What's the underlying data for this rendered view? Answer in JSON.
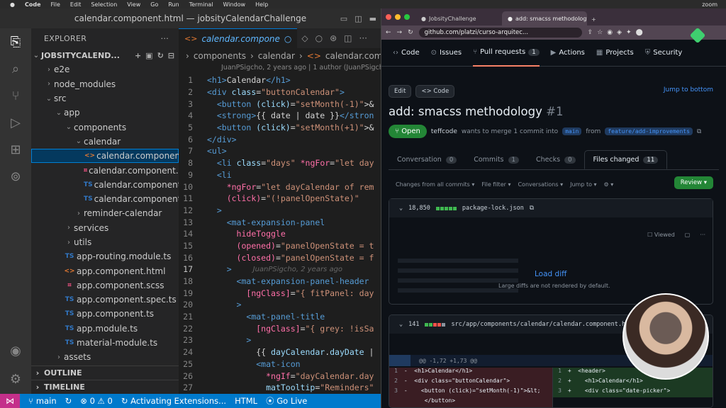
{
  "mac_menu": {
    "app": "Code",
    "items": [
      "File",
      "Edit",
      "Selection",
      "View",
      "Go",
      "Run",
      "Terminal",
      "Window",
      "Help"
    ],
    "right": [
      "zoom"
    ]
  },
  "vscode": {
    "window_title": "calendar.component.html — jobsityCalendarChallenge",
    "explorer_label": "EXPLORER",
    "project": "JOBSITYCALEND...",
    "tree": [
      {
        "label": "e2e",
        "depth": 1,
        "type": "folder",
        "open": false
      },
      {
        "label": "node_modules",
        "depth": 1,
        "type": "folder",
        "open": false
      },
      {
        "label": "src",
        "depth": 1,
        "type": "folder",
        "open": true
      },
      {
        "label": "app",
        "depth": 2,
        "type": "folder",
        "open": true
      },
      {
        "label": "components",
        "depth": 3,
        "type": "folder",
        "open": true
      },
      {
        "label": "calendar",
        "depth": 4,
        "type": "folder",
        "open": true
      },
      {
        "label": "calendar.component.html",
        "depth": 5,
        "type": "html",
        "state": "selected"
      },
      {
        "label": "calendar.component.scss",
        "depth": 5,
        "type": "scss",
        "state": "hover"
      },
      {
        "label": "calendar.component.sp...",
        "depth": 5,
        "type": "ts"
      },
      {
        "label": "calendar.component.ts",
        "depth": 5,
        "type": "ts"
      },
      {
        "label": "reminder-calendar",
        "depth": 4,
        "type": "folder",
        "open": false
      },
      {
        "label": "services",
        "depth": 3,
        "type": "folder",
        "open": false
      },
      {
        "label": "utils",
        "depth": 3,
        "type": "folder",
        "open": false
      },
      {
        "label": "app-routing.module.ts",
        "depth": 3,
        "type": "ts"
      },
      {
        "label": "app.component.html",
        "depth": 3,
        "type": "html"
      },
      {
        "label": "app.component.scss",
        "depth": 3,
        "type": "scss"
      },
      {
        "label": "app.component.spec.ts",
        "depth": 3,
        "type": "ts"
      },
      {
        "label": "app.component.ts",
        "depth": 3,
        "type": "ts"
      },
      {
        "label": "app.module.ts",
        "depth": 3,
        "type": "ts"
      },
      {
        "label": "material-module.ts",
        "depth": 3,
        "type": "ts"
      },
      {
        "label": "assets",
        "depth": 2,
        "type": "folder",
        "open": false
      }
    ],
    "outline_label": "OUTLINE",
    "timeline_label": "TIMELINE",
    "tab_label": "calendar.compone",
    "breadcrumb": [
      "components",
      "calendar",
      "calendar.compone"
    ],
    "blame_header": "JuanPSigcho, 2 years ago | 1 author (JuanPSigch...",
    "inline_blame": "JuanPSigcho, 2 years ago",
    "current_line": 17,
    "code": [
      {
        "n": 1,
        "html": "<span class='t'>&lt;h1&gt;</span>Calendar<span class='t'>&lt;/h1&gt;</span>"
      },
      {
        "n": 2,
        "html": "<span class='t'>&lt;div</span> <span class='a'>class</span>=<span class='s'>\"buttonCalendar\"</span><span class='t'>&gt;</span>"
      },
      {
        "n": 3,
        "html": "  <span class='t'>&lt;button</span> <span class='a'>(click)</span>=<span class='s'>\"setMonth(-1)\"</span>&gt;&amp;"
      },
      {
        "n": 4,
        "html": "  <span class='t'>&lt;strong&gt;</span>{{ date | date }}<span class='t'>&lt;/stron</span>"
      },
      {
        "n": 5,
        "html": "  <span class='t'>&lt;button</span> <span class='a'>(click)</span>=<span class='s'>\"setMonth(+1)\"</span>&gt;&amp;"
      },
      {
        "n": 6,
        "html": "<span class='t'>&lt;/div&gt;</span>"
      },
      {
        "n": 7,
        "html": "<span class='t'>&lt;ul&gt;</span>"
      },
      {
        "n": 8,
        "html": "  <span class='t'>&lt;li</span> <span class='a'>class</span>=<span class='s'>\"days\"</span> <span class='pk'>*ngFor</span>=<span class='s'>\"let day</span>"
      },
      {
        "n": 9,
        "html": "  <span class='t'>&lt;li</span>"
      },
      {
        "n": 10,
        "html": "    <span class='pk'>*ngFor</span>=<span class='s'>\"let dayCalendar of rem</span>"
      },
      {
        "n": 11,
        "html": "    <span class='pk'>(click)</span>=<span class='s'>\"(!panelOpenState)\"</span>"
      },
      {
        "n": 12,
        "html": "  <span class='t'>&gt;</span>"
      },
      {
        "n": 13,
        "html": "    <span class='t'>&lt;mat-expansion-panel</span>"
      },
      {
        "n": 14,
        "html": "      <span class='pk'>hideToggle</span>"
      },
      {
        "n": 15,
        "html": "      <span class='pk'>(opened)</span>=<span class='s'>\"panelOpenState = t</span>"
      },
      {
        "n": 16,
        "html": "      <span class='pk'>(closed)</span>=<span class='s'>\"panelOpenState = f</span>"
      },
      {
        "n": 17,
        "html": "    <span class='t'>&gt;</span>"
      },
      {
        "n": 18,
        "html": "      <span class='t'>&lt;mat-expansion-panel-header</span>"
      },
      {
        "n": 19,
        "html": "        <span class='pk'>[ngClass]</span>=<span class='s'>\"{ fitPanel: day</span>"
      },
      {
        "n": 20,
        "html": "      <span class='t'>&gt;</span>"
      },
      {
        "n": 21,
        "html": "        <span class='t'>&lt;mat-panel-title</span>"
      },
      {
        "n": 22,
        "html": "          <span class='pk'>[ngClass]</span>=<span class='s'>\"{ grey: !isSa</span>"
      },
      {
        "n": 23,
        "html": "        <span class='t'>&gt;</span>"
      },
      {
        "n": 24,
        "html": "          {{ <span class='a'>dayCalendar</span>.<span class='a'>dayDate</span> |"
      },
      {
        "n": 25,
        "html": "          <span class='t'>&lt;mat-icon</span>"
      },
      {
        "n": 26,
        "html": "            <span class='pk'>*ngIf</span>=<span class='s'>\"dayCalendar.day</span>"
      },
      {
        "n": 27,
        "html": "            <span class='a'>matTooltip</span>=<span class='s'>\"Reminders\"</span>"
      }
    ],
    "status": {
      "branch": "main",
      "errors": "0",
      "warnings": "0",
      "activity": "Activating Extensions...",
      "lang": "HTML",
      "golive": "Go Live"
    }
  },
  "browser": {
    "tabs": [
      {
        "label": "JobsityChallenge",
        "active": false
      },
      {
        "label": "add: smacss methodology by",
        "active": true
      }
    ],
    "url": "github.com/platzi/curso-arquitec...",
    "repo_nav": [
      {
        "label": "Code",
        "count": null,
        "active": false
      },
      {
        "label": "Issues",
        "count": null,
        "active": false
      },
      {
        "label": "Pull requests",
        "count": "1",
        "active": true
      },
      {
        "label": "Actions",
        "count": null,
        "active": false
      },
      {
        "label": "Projects",
        "count": null,
        "active": false
      },
      {
        "label": "Security",
        "count": null,
        "active": false
      }
    ],
    "edit_label": "Edit",
    "code_label": "<> Code",
    "jump_label": "Jump to bottom",
    "pr_title": "add: smacss methodology",
    "pr_number": "#1",
    "status": "Open",
    "author": "teffcode",
    "meta_mid": "wants to merge 1 commit into",
    "base": "main",
    "from": "from",
    "head": "feature/add-improvements",
    "pr_tabs": [
      {
        "label": "Conversation",
        "count": "0"
      },
      {
        "label": "Commits",
        "count": "1"
      },
      {
        "label": "Checks",
        "count": "0"
      },
      {
        "label": "Files changed",
        "count": "11",
        "active": true
      }
    ],
    "toolbar": [
      "Changes from all commits ▾",
      "File filter ▾",
      "Conversations ▾",
      "Jump to ▾",
      "⚙ ▾"
    ],
    "review_label": "Review ▾",
    "file1": {
      "stat": "18,850",
      "name": "package-lock.json",
      "viewed": "Viewed",
      "load": "Load diff",
      "note": "Large diffs are not rendered by default."
    },
    "file2": {
      "stat": "141",
      "name": "src/app/components/calendar/calendar.component.html",
      "hunk": "@@ -1,72 +1,73 @@",
      "rows": [
        {
          "dn": "1",
          "dtext": " -  <h1>Calendar</h1>",
          "an": "1",
          "atext": " +  <header>"
        },
        {
          "dn": "2",
          "dtext": " -  <div class=\"buttonCalendar\">",
          "an": "2",
          "atext": " +    <h1>Calendar</h1>"
        },
        {
          "dn": "3",
          "dtext": " -    <button (click)=\"setMonth(-1)\">&lt;",
          "an": "3",
          "atext": " +    <div class=\"date-picker\">"
        },
        {
          "dn": "",
          "dtext": "       </button>",
          "an": "",
          "atext": ""
        }
      ]
    }
  }
}
